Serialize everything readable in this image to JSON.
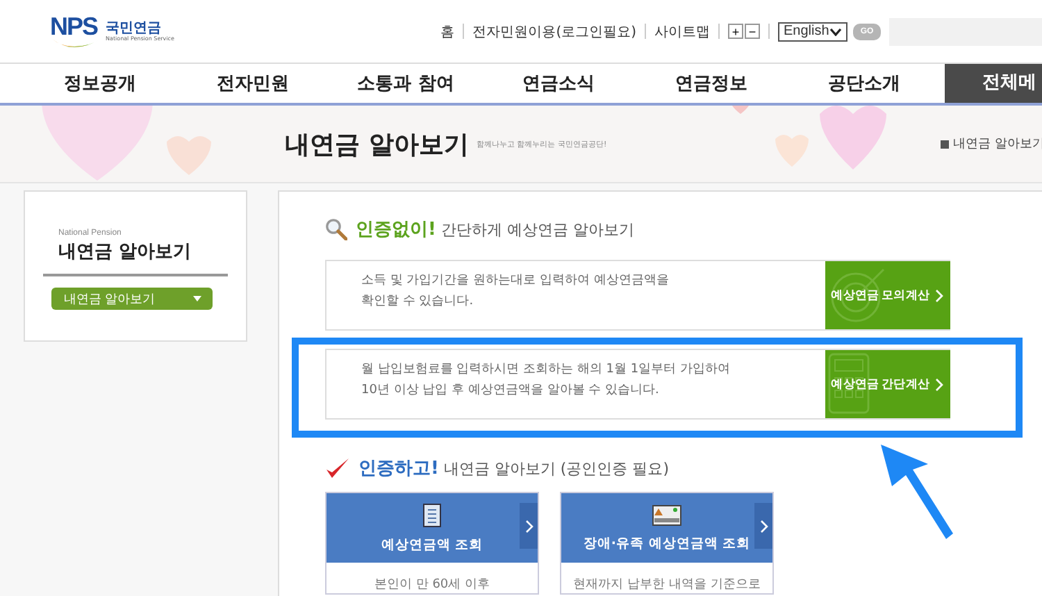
{
  "header": {
    "logo": {
      "mark": "NPS",
      "name": "국민연금",
      "sub": "National Pension Service"
    },
    "util_links": [
      "홈",
      "전자민원이용(로그인필요)",
      "사이트맵"
    ],
    "font_buttons": [
      "+",
      "−"
    ],
    "language": "English",
    "go": "GO"
  },
  "nav": {
    "items": [
      {
        "label": "정보공개",
        "kind": "menu"
      },
      {
        "label": "전자민원",
        "kind": "menu"
      },
      {
        "label": "소통과 참여",
        "kind": "menu"
      },
      {
        "label": "연금소식",
        "kind": "menu"
      },
      {
        "label": "연금정보",
        "kind": "menu"
      },
      {
        "label": "공단소개",
        "kind": "menu"
      },
      {
        "label": "전체메",
        "kind": "all"
      }
    ]
  },
  "banner": {
    "title": "내연금 알아보기",
    "slogan": "함께나누고 함께누리는 국민연금공단!",
    "breadcrumb": "내연금 알아보기"
  },
  "sidebar": {
    "eyebrow": "National Pension",
    "title": "내연금 알아보기",
    "dropdown": "내연금 알아보기"
  },
  "section_1": {
    "highlight": "인증없이!",
    "rest": "간단하게 예상연금 알아보기",
    "options": [
      {
        "lines": [
          "소득 및 가입기간을 원하는대로 입력하여 예상연금액을",
          "확인할 수 있습니다."
        ],
        "button": "예상연금 모의계산",
        "highlighted": false
      },
      {
        "lines": [
          "월 납입보험료를 입력하시면 조회하는 해의 1월 1일부터 가입하여",
          "10년 이상 납입 후 예상연금액을 알아볼 수 있습니다."
        ],
        "button": "예상연금 간단계산",
        "highlighted": true
      }
    ]
  },
  "section_2": {
    "highlight": "인증하고!",
    "rest": "내연금 알아보기 (공인인증 필요)",
    "cards": [
      {
        "title": "예상연금액 조회",
        "body": "본인이 만 60세 이후"
      },
      {
        "title": "장애·유족 예상연금액 조회",
        "body": "현재까지 납부한 내역을 기준으로"
      }
    ]
  }
}
